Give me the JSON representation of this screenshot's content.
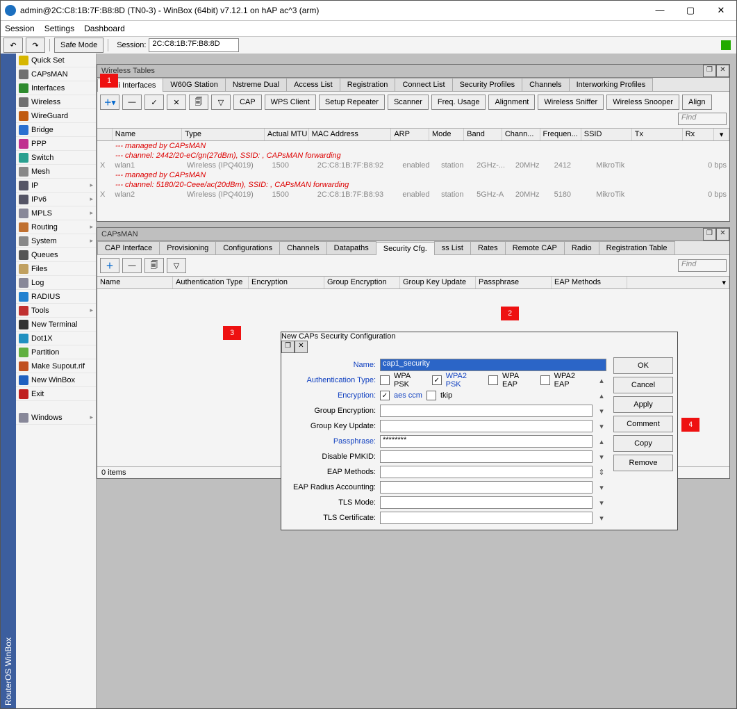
{
  "window": {
    "title": "admin@2C:C8:1B:7F:B8:8D (TN0-3) - WinBox (64bit) v7.12.1 on hAP ac^3 (arm)",
    "min": "—",
    "max": "▢",
    "close": "✕"
  },
  "menus": [
    "Session",
    "Settings",
    "Dashboard"
  ],
  "safe_mode": "Safe Mode",
  "session_label": "Session:",
  "session_value": "2C:C8:1B:7F:B8:8D",
  "rot_label": "RouterOS  WinBox",
  "sidebar": [
    {
      "label": "Quick Set",
      "color": "#d6b600"
    },
    {
      "label": "CAPsMAN",
      "color": "#707070"
    },
    {
      "label": "Interfaces",
      "color": "#2e8b2e"
    },
    {
      "label": "Wireless",
      "color": "#707070"
    },
    {
      "label": "WireGuard",
      "color": "#c05a10"
    },
    {
      "label": "Bridge",
      "color": "#2a6fd0"
    },
    {
      "label": "PPP",
      "color": "#c03090"
    },
    {
      "label": "Switch",
      "color": "#2aa090"
    },
    {
      "label": "Mesh",
      "color": "#888"
    },
    {
      "label": "IP",
      "color": "#556",
      "sub": true
    },
    {
      "label": "IPv6",
      "color": "#556",
      "sub": true
    },
    {
      "label": "MPLS",
      "color": "#889",
      "sub": true
    },
    {
      "label": "Routing",
      "color": "#c07030",
      "sub": true
    },
    {
      "label": "System",
      "color": "#888",
      "sub": true
    },
    {
      "label": "Queues",
      "color": "#555"
    },
    {
      "label": "Files",
      "color": "#c0a060"
    },
    {
      "label": "Log",
      "color": "#889"
    },
    {
      "label": "RADIUS",
      "color": "#2080d0"
    },
    {
      "label": "Tools",
      "color": "#c03030",
      "sub": true
    },
    {
      "label": "New Terminal",
      "color": "#333"
    },
    {
      "label": "Dot1X",
      "color": "#2090c0"
    },
    {
      "label": "Partition",
      "color": "#60b040"
    },
    {
      "label": "Make Supout.rif",
      "color": "#c05020"
    },
    {
      "label": "New WinBox",
      "color": "#2060c0"
    },
    {
      "label": "Exit",
      "color": "#c02020"
    },
    {
      "label": "",
      "spacer": true
    },
    {
      "label": "Windows",
      "color": "#889",
      "sub": true
    }
  ],
  "wt": {
    "title": "Wireless Tables",
    "tabs": [
      "WiFi Interfaces",
      "W60G Station",
      "Nstreme Dual",
      "Access List",
      "Registration",
      "Connect List",
      "Security Profiles",
      "Channels",
      "Interworking Profiles"
    ],
    "btns": [
      "CAP",
      "WPS Client",
      "Setup Repeater",
      "Scanner",
      "Freq. Usage",
      "Alignment",
      "Wireless Sniffer",
      "Wireless Snooper",
      "Align"
    ],
    "find": "Find",
    "cols": [
      "",
      "Name",
      "Type",
      "Actual MTU",
      "MAC Address",
      "ARP",
      "Mode",
      "Band",
      "Chann...",
      "Frequen...",
      "SSID",
      "Tx",
      "Rx",
      ""
    ],
    "notes": [
      "--- managed by CAPsMAN",
      "--- channel: 2442/20-eC/gn(27dBm), SSID: , CAPsMAN forwarding",
      "--- managed by CAPsMAN",
      "--- channel: 5180/20-Ceee/ac(20dBm), SSID: , CAPsMAN forwarding"
    ],
    "rows": [
      {
        "c": [
          "X",
          "wlan1",
          "Wireless (IPQ4019)",
          "1500",
          "2C:C8:1B:7F:B8:92",
          "enabled",
          "station",
          "2GHz-...",
          "20MHz",
          "2412",
          "MikroTik",
          "",
          "0 bps"
        ]
      },
      {
        "c": [
          "X",
          "wlan2",
          "Wireless (IPQ4019)",
          "1500",
          "2C:C8:1B:7F:B8:93",
          "enabled",
          "station",
          "5GHz-A",
          "20MHz",
          "5180",
          "MikroTik",
          "",
          "0 bps"
        ]
      }
    ]
  },
  "cm": {
    "title": "CAPsMAN",
    "tabs": [
      "CAP Interface",
      "Provisioning",
      "Configurations",
      "Channels",
      "Datapaths",
      "Security Cfg.",
      "ss List",
      "Rates",
      "Remote CAP",
      "Radio",
      "Registration Table"
    ],
    "find": "Find",
    "cols": [
      "Name",
      "Authentication Type",
      "Encryption",
      "Group Encryption",
      "Group Key Update",
      "Passphrase",
      "EAP Methods",
      ""
    ],
    "status": "0 items"
  },
  "dlg": {
    "title": "New CAPs Security Configuration",
    "labels": {
      "name": "Name:",
      "auth": "Authentication Type:",
      "enc": "Encryption:",
      "genc": "Group Encryption:",
      "gku": "Group Key Update:",
      "pass": "Passphrase:",
      "pmk": "Disable PMKID:",
      "eapm": "EAP Methods:",
      "eapr": "EAP Radius Accounting:",
      "tlsm": "TLS Mode:",
      "tlsc": "TLS Certificate:"
    },
    "name_value": "cap1_security",
    "auth_opts": [
      "WPA PSK",
      "WPA2 PSK",
      "WPA EAP",
      "WPA2 EAP"
    ],
    "enc_opts": [
      "aes ccm",
      "tkip"
    ],
    "pass_value": "********",
    "btns": [
      "OK",
      "Cancel",
      "Apply",
      "Comment",
      "Copy",
      "Remove"
    ]
  },
  "markers": {
    "m1": "1",
    "m2": "2",
    "m3": "3",
    "m4": "4"
  }
}
